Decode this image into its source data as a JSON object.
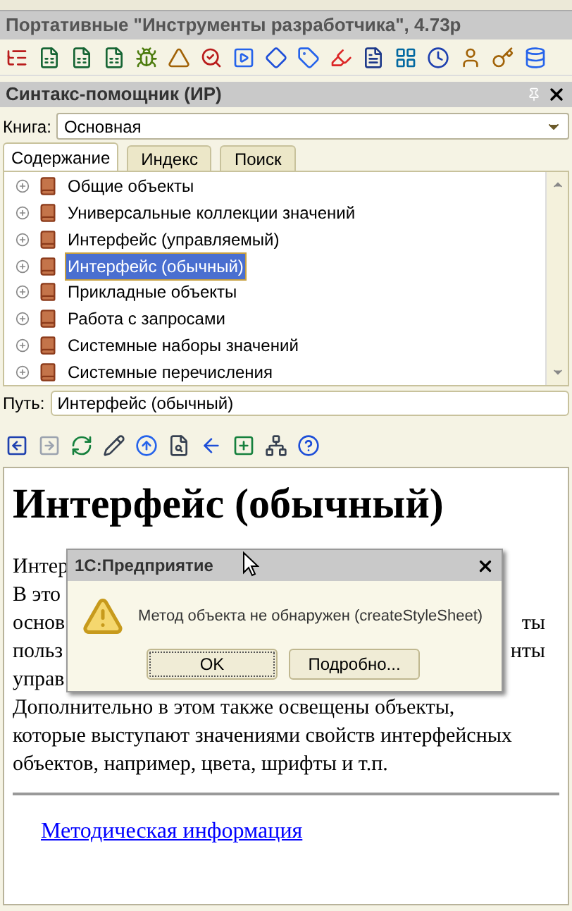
{
  "window": {
    "title": "Портативные \"Инструменты разработчика\", 4.73p"
  },
  "panel": {
    "title": "Синтакс-помощник (ИР)",
    "book_label": "Книга:",
    "book_value": "Основная"
  },
  "tabs": [
    {
      "label": "Содержание",
      "selected": true
    },
    {
      "label": "Индекс",
      "selected": false
    },
    {
      "label": "Поиск",
      "selected": false
    }
  ],
  "tree": [
    {
      "label": "Общие объекты",
      "selected": false
    },
    {
      "label": "Универсальные коллекции значений",
      "selected": false
    },
    {
      "label": "Интерфейс (управляемый)",
      "selected": false
    },
    {
      "label": "Интерфейс (обычный)",
      "selected": true
    },
    {
      "label": "Прикладные объекты",
      "selected": false
    },
    {
      "label": "Работа с запросами",
      "selected": false
    },
    {
      "label": "Системные наборы значений",
      "selected": false
    },
    {
      "label": "Системные перечисления",
      "selected": false
    }
  ],
  "path": {
    "label": "Путь:",
    "value": "Интерфейс (обычный)"
  },
  "article": {
    "heading": "Интерфейс (обычный)",
    "lines": [
      {
        "left": "Интер"
      },
      {
        "left": "В это"
      },
      {
        "left": "основ",
        "right": "ты"
      },
      {
        "left": "польз",
        "right": "нты"
      },
      {
        "left": "управ"
      },
      {
        "left": "Дополнительно в этом также освещены объекты,"
      },
      {
        "left": "которые выступают значениями свойств интерфейсных"
      },
      {
        "left": "объектов, например, цвета, шрифты и т.п."
      }
    ],
    "link": "Методическая информация"
  },
  "dialog": {
    "title": "1С:Предприятие",
    "message": "Метод объекта не обнаружен (createStyleSheet)",
    "buttons": [
      {
        "label": "OK",
        "selected": true
      },
      {
        "label": "Подробно...",
        "selected": false
      }
    ]
  }
}
